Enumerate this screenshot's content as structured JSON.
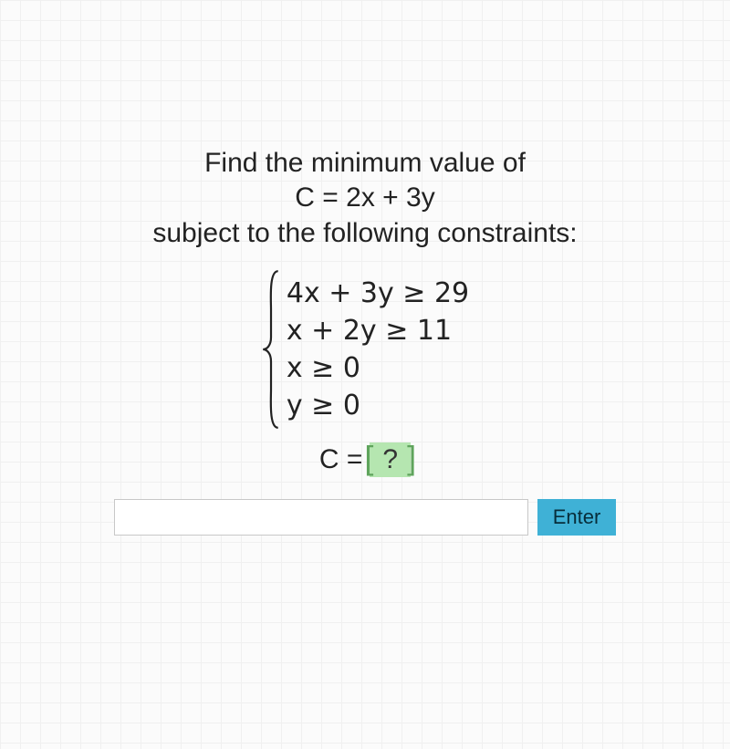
{
  "prompt": {
    "line1": "Find the minimum value of",
    "line2": "C = 2x + 3y",
    "line3": "subject to the following constraints:"
  },
  "constraints": [
    "4x + 3y ≥ 29",
    "x + 2y ≥ 11",
    "x ≥ 0",
    "y ≥ 0"
  ],
  "answer": {
    "prefix": "C =",
    "placeholder": "?"
  },
  "input": {
    "value": "",
    "button": "Enter"
  }
}
